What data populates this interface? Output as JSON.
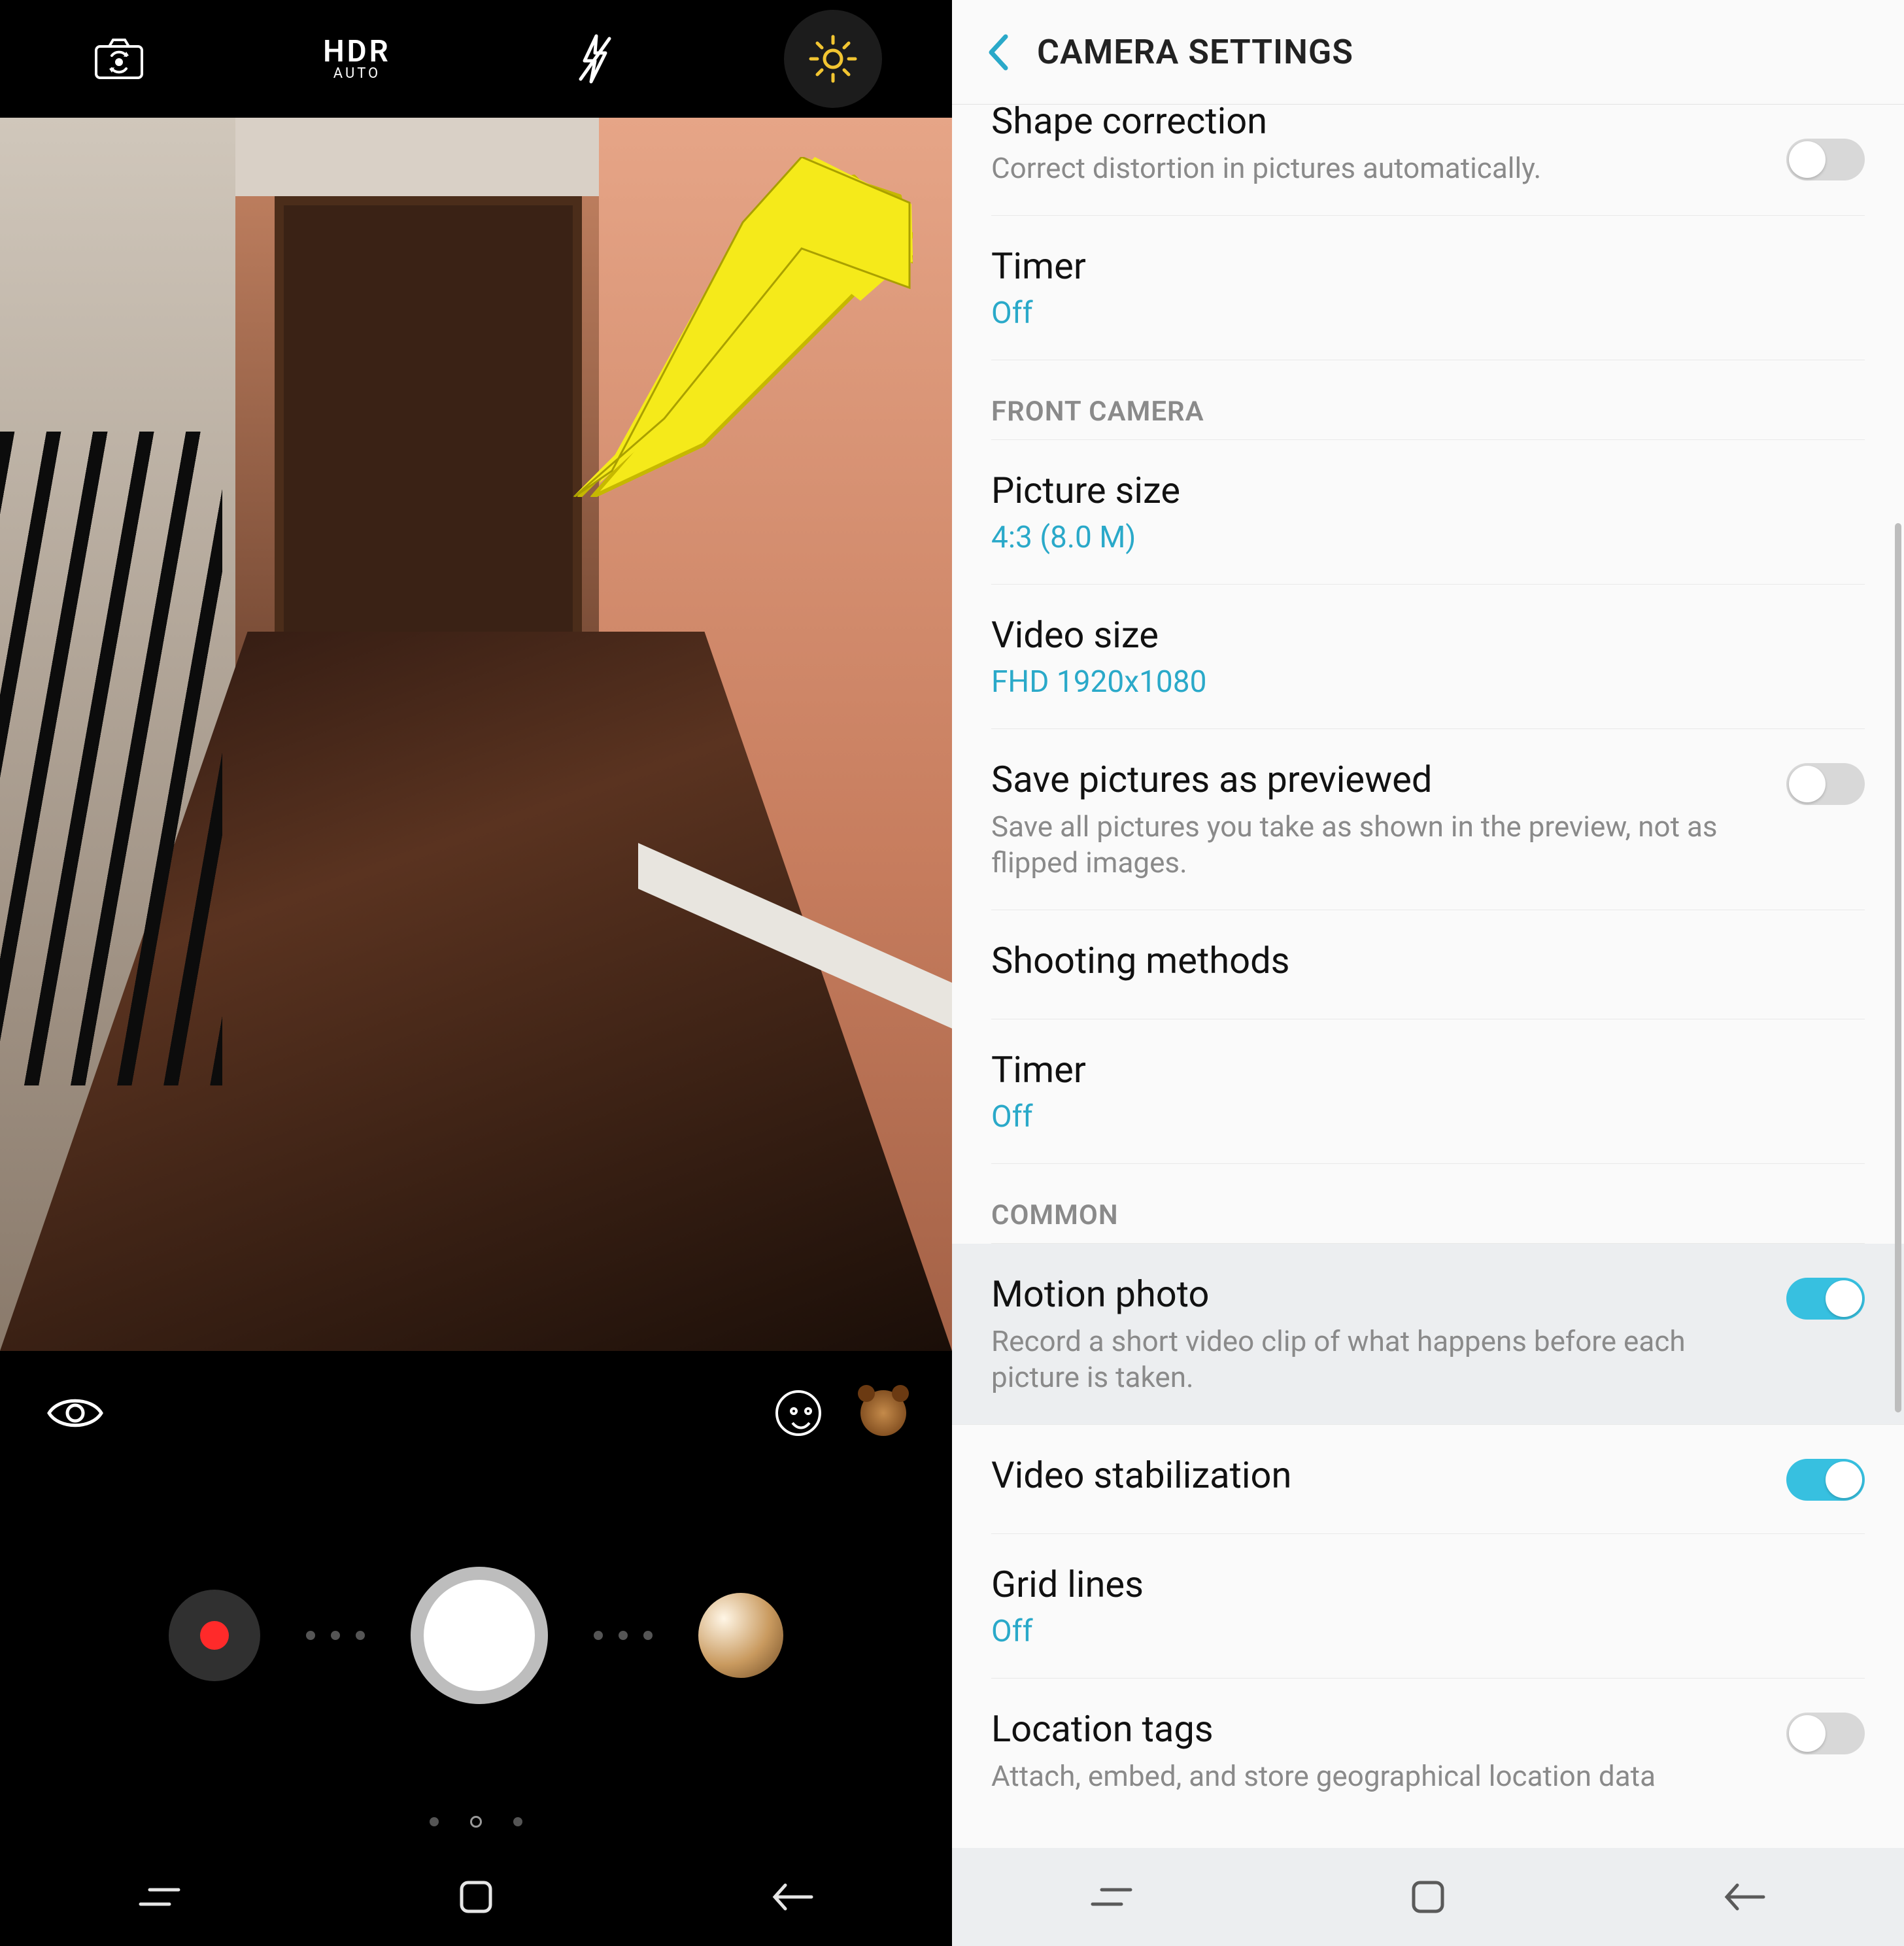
{
  "left": {
    "topbar": {
      "hdr_label": "HDR",
      "hdr_mode": "AUTO"
    }
  },
  "right": {
    "header_title": "CAMERA SETTINGS",
    "rows": {
      "shape_correction": {
        "title": "Shape correction",
        "sub": "Correct distortion in pictures automatically."
      },
      "timer_rear": {
        "title": "Timer",
        "value": "Off"
      },
      "section_front": "FRONT CAMERA",
      "picture_size": {
        "title": "Picture size",
        "value": "4:3 (8.0 M)"
      },
      "video_size": {
        "title": "Video size",
        "value": "FHD 1920x1080"
      },
      "save_prev": {
        "title": "Save pictures as previewed",
        "sub": "Save all pictures you take as shown in the preview, not as flipped images."
      },
      "shooting_methods": {
        "title": "Shooting methods"
      },
      "timer_front": {
        "title": "Timer",
        "value": "Off"
      },
      "section_common": "COMMON",
      "motion_photo": {
        "title": "Motion photo",
        "sub": "Record a short video clip of what happens before each picture is taken."
      },
      "video_stab": {
        "title": "Video stabilization"
      },
      "grid_lines": {
        "title": "Grid lines",
        "value": "Off"
      },
      "location_tags": {
        "title": "Location tags",
        "sub": "Attach, embed, and store geographical location data"
      }
    }
  }
}
